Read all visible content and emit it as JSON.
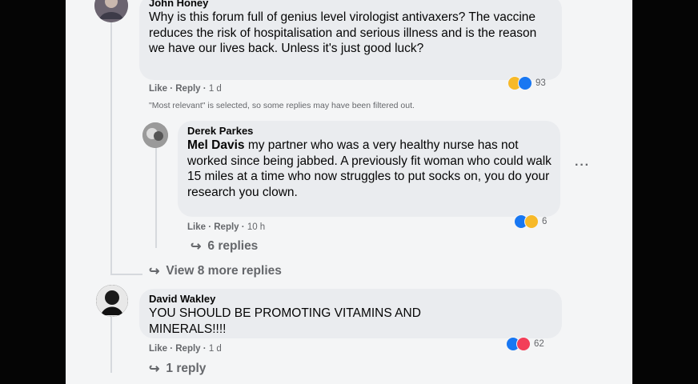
{
  "comments": {
    "c1": {
      "author": "John Honey",
      "text": "Why is this forum full of genius level virologist antivaxers? The vaccine reduces the risk of hospitalisation and serious illness and is the reason we have our lives back. Unless it's just good luck?",
      "like": "Like",
      "reply": "Reply",
      "time": "1 d",
      "reactions": "93",
      "filter_note": "\"Most relevant\" is selected, so some replies may have been filtered out."
    },
    "c2": {
      "author": "Derek Parkes",
      "mention": "Mel Davis",
      "text": " my partner who was a very healthy nurse has not worked since being jabbed. A previously fit woman who could walk 15 miles at a time who now struggles to put socks on, you do your research you clown.",
      "like": "Like",
      "reply": "Reply",
      "time": "10 h",
      "reactions": "6",
      "replies": "6 replies"
    },
    "view_more": "View 8 more replies",
    "c3": {
      "author": "David Wakley",
      "text": "YOU SHOULD BE PROMOTING VITAMINS AND MINERALS!!!!",
      "like": "Like",
      "reply": "Reply",
      "time": "1 d",
      "reactions": "62",
      "replies": "1 reply"
    }
  },
  "icons": {
    "more": "more-options-icon",
    "like": "like-reaction-icon",
    "haha": "haha-reaction-icon",
    "love": "love-reaction-icon",
    "reply_arrow": "reply-arrow-icon"
  },
  "colors": {
    "like_blue": "#1877f2",
    "haha_yellow": "#f7b928",
    "love_red": "#f33e58"
  }
}
